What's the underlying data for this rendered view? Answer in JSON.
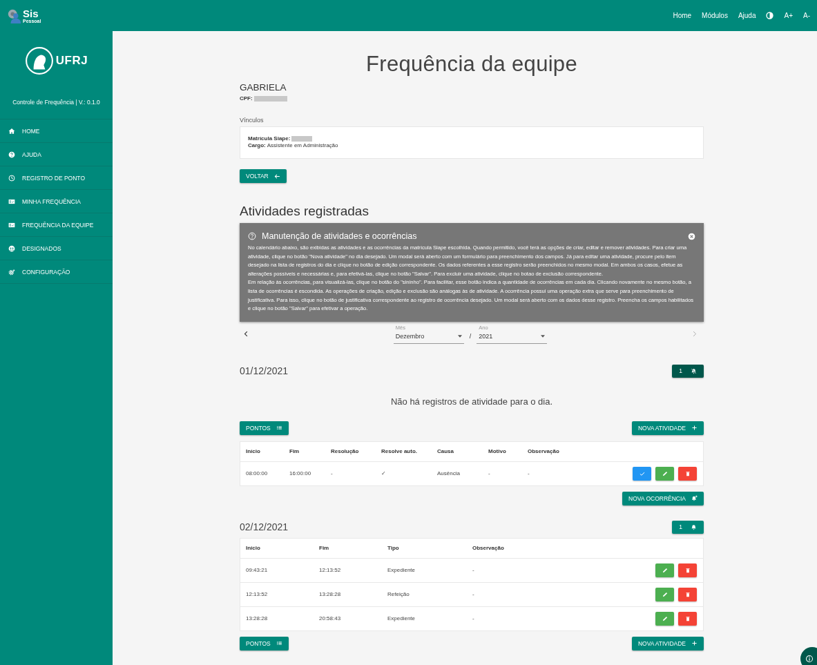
{
  "topbar": {
    "logo": {
      "name": "Sis",
      "subtitle": "Pessoal"
    },
    "nav": [
      "Home",
      "Módulos",
      "Ajuda"
    ],
    "font_buttons": [
      "A+",
      "A-"
    ]
  },
  "sidebar": {
    "org": "UFRJ",
    "app_version": "Controle de Frequência | V.: 0.1.0",
    "items": [
      {
        "kind": "home",
        "label": "HOME"
      },
      {
        "kind": "help",
        "label": "AJUDA"
      },
      {
        "kind": "clock",
        "label": "REGISTRO DE PONTO"
      },
      {
        "kind": "card",
        "label": "MINHA FREQUÊNCIA"
      },
      {
        "kind": "card",
        "label": "FREQUÊNCIA DA EQUIPE"
      },
      {
        "kind": "group",
        "label": "DESIGNADOS"
      },
      {
        "kind": "gear",
        "label": "CONFIGURAÇÃO"
      }
    ]
  },
  "page": {
    "title": "Frequência da equipe",
    "person": {
      "name": "GABRIELA",
      "cpf": {
        "label": "CPF:",
        "redacted": true
      }
    },
    "links": {
      "title": "Vínculos",
      "siape": {
        "label": "Matrícula Siape:",
        "redacted": true
      },
      "cargo": {
        "label": "Cargo:",
        "value": "Assistente em Administração"
      }
    },
    "back_button": "VOLTAR"
  },
  "activities": {
    "title": "Atividades registradas",
    "help": {
      "title": "Manutenção de atividades e ocorrências",
      "paragraphs": [
        "No calendário abaixo, são exibidas as atividades e as ocorrências da matrícula Siape escolhida. Quando permitido, você terá as opções de criar, editar e remover atividades. Para criar uma atividade, clique no botão \"Nova atividade\" no dia desejado. Um modal será aberto com um formulário para preenchimento dos campos. Já para editar uma atividade, procure pelo item desejado na lista de registros do dia e clique no botão de edição correspondente. Os dados referentes a esse registro serão preenchidos no mesmo modal. Em ambos os casos, efetue as alterações possíveis e necessárias e, para efetivá-las, clique no botão \"Salvar\". Para excluir uma atividade, clique no botao de exclusão correspondente.",
        "Em relação às ocorrências, para visualizá-las, clique no botão do \"sininho\". Para facilitar, esse botão indica a quantidade de ocorrências em cada dia. Clicando novamente no mesmo botão, a lista de ocorrências é escondida. As operações de criação, edição e exclusão são análogas às de atividade. A ocorrência possui uma operação extra que serve para preenchimento de justificativa. Para isso, clique no botão de justificativa correspondente ao registro de ocorrência desejado. Um modal será aberto com os dados desse registro. Preencha os campos habilitados e clique no botão \"Salvar\" para efetivar a operação."
      ]
    },
    "month": {
      "label": "Mês",
      "value": "Dezembro"
    },
    "separator": "/",
    "year": {
      "label": "Ano",
      "value": "2021"
    }
  },
  "days": [
    {
      "date": "01/12/2021",
      "bell": {
        "count": "1",
        "muted": true
      },
      "blocks": [
        {
          "kind": "message",
          "text": "Não há registros de atividade para o dia."
        },
        {
          "kind": "actions",
          "buttons": [
            {
              "kind": "points",
              "label": "PONTOS"
            },
            {
              "kind": "add_activity",
              "label": "NOVA ATIVIDADE"
            }
          ]
        },
        {
          "kind": "occurrence_table",
          "columns": [
            "Início",
            "Fim",
            "Resolução",
            "Resolve auto.",
            "Causa",
            "Motivo",
            "Observação"
          ],
          "rows": [
            {
              "cells": [
                "08:00:00",
                "16:00:00",
                "-",
                "✓",
                "Ausência",
                "-",
                "-"
              ],
              "actions": [
                {
                  "kind": "justify"
                },
                {
                  "kind": "edit"
                },
                {
                  "kind": "delete"
                }
              ]
            }
          ]
        },
        {
          "kind": "actions",
          "buttons": [
            {
              "kind": "add_occurrence",
              "label": "NOVA OCORRÊNCIA"
            }
          ]
        }
      ]
    },
    {
      "date": "02/12/2021",
      "bell": {
        "count": "1",
        "muted": false
      },
      "blocks": [
        {
          "kind": "activity_table",
          "columns": [
            "Início",
            "Fim",
            "Tipo",
            "Observação"
          ],
          "rows": [
            {
              "cells": [
                "09:43:21",
                "12:13:52",
                "Expediente",
                "-"
              ],
              "actions": [
                {
                  "kind": "edit"
                },
                {
                  "kind": "delete"
                }
              ]
            },
            {
              "cells": [
                "12:13:52",
                "13:28:28",
                "Refeição",
                "-"
              ],
              "actions": [
                {
                  "kind": "edit"
                },
                {
                  "kind": "delete"
                }
              ]
            },
            {
              "cells": [
                "13:28:28",
                "20:58:43",
                "Expediente",
                "-"
              ],
              "actions": [
                {
                  "kind": "edit"
                },
                {
                  "kind": "delete"
                }
              ]
            }
          ]
        },
        {
          "kind": "actions",
          "buttons": [
            {
              "kind": "points",
              "label": "PONTOS"
            },
            {
              "kind": "add_activity",
              "label": "NOVA ATIVIDADE"
            }
          ]
        }
      ]
    }
  ]
}
